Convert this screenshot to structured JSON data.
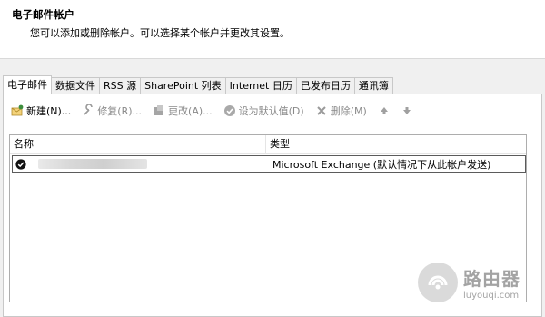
{
  "header": {
    "title": "电子邮件帐户",
    "subtitle": "您可以添加或删除帐户。可以选择某个帐户并更改其设置。"
  },
  "tabs": [
    {
      "label": "电子邮件",
      "active": true
    },
    {
      "label": "数据文件"
    },
    {
      "label": "RSS 源"
    },
    {
      "label": "SharePoint 列表"
    },
    {
      "label": "Internet 日历"
    },
    {
      "label": "已发布日历"
    },
    {
      "label": "通讯簿"
    }
  ],
  "toolbar": {
    "new_label": "新建(N)...",
    "repair_label": "修复(R)...",
    "change_label": "更改(A)...",
    "default_label": "设为默认值(D)",
    "delete_label": "删除(M)"
  },
  "list": {
    "columns": [
      "名称",
      "类型"
    ],
    "rows": [
      {
        "name": "",
        "type": "Microsoft Exchange (默认情况下从此帐户发送)",
        "default": true
      }
    ]
  },
  "watermark": {
    "brand": "路由器",
    "site": "luyouqi.com"
  },
  "colors": {
    "header_bg": "#ffffff",
    "window_bg": "#f0f0f0",
    "disabled_text": "#8a8a8a"
  }
}
